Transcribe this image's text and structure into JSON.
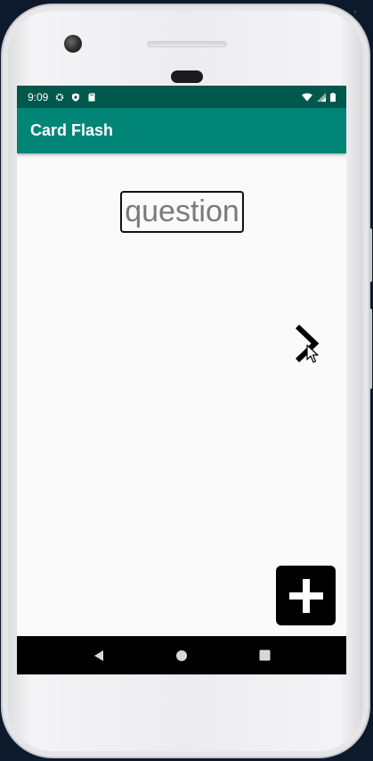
{
  "status_bar": {
    "time": "9:09",
    "icons_left": [
      "gear-icon",
      "shield-icon",
      "sd-card-icon"
    ],
    "icons_right": [
      "wifi-icon",
      "signal-icon",
      "battery-icon"
    ],
    "color": "#00574b"
  },
  "app_bar": {
    "title": "Card Flash",
    "color": "#008577"
  },
  "card": {
    "question_text": "question"
  },
  "controls": {
    "next_icon": "chevron-right-icon",
    "add_icon": "plus-icon"
  },
  "nav_bar": {
    "buttons": [
      "back-icon",
      "home-icon",
      "recents-icon"
    ]
  }
}
